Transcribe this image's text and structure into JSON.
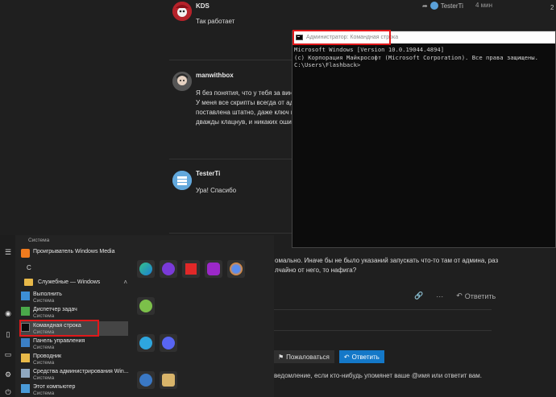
{
  "forum": {
    "posts": [
      {
        "author": "KDS",
        "lines": [
          "Так работает"
        ],
        "reply_to": "TesterTi",
        "time": "4 мин"
      },
      {
        "author": "manwithbox",
        "lines": [
          "Я без понятия, что у тебя за винда",
          "У меня все скрипты всегда от адми",
          "поставлена штатно, даже ключ имп",
          "дважды клацнув, и никаких ошибок"
        ]
      },
      {
        "author": "TesterTi",
        "lines": [
          "Ура! Спасибо"
        ]
      }
    ],
    "partial_text": [
      "омально. Иначе бы не было указаний запускать что-то там от админа, раз",
      "лчайно от него, то нафига?"
    ],
    "actions": {
      "reply": "Ответить"
    },
    "share_label": "Пожаловаться",
    "reply_button": "Ответить",
    "notice": "ведомление, если кто-нибудь упомянет ваше @имя или ответит вам.",
    "edge_digit": "2"
  },
  "cmd": {
    "title": "Администратор: Командная строка",
    "lines": [
      "Microsoft Windows [Version 10.0.19044.4894]",
      "(c) Корпорация Майкрософт (Microsoft Corporation). Все права защищены.",
      "",
      "C:\\Users\\Flashback>"
    ]
  },
  "start_menu": {
    "top_sub": "Система",
    "letter": "С",
    "group": "Служебные — Windows",
    "apps": [
      {
        "name": "Проигрыватель Windows Media",
        "sub": ""
      },
      {
        "name": "Выполнить",
        "sub": "Система"
      },
      {
        "name": "Диспетчер задач",
        "sub": "Система"
      },
      {
        "name": "Командная строка",
        "sub": "Система"
      },
      {
        "name": "Панель управления",
        "sub": "Система"
      },
      {
        "name": "Проводник",
        "sub": "Система"
      },
      {
        "name": "Средства администрирования Win...",
        "sub": "Система"
      },
      {
        "name": "Этот компьютер",
        "sub": "Система"
      }
    ]
  },
  "colors": {
    "accent": "#1478c8",
    "highlight": "#e0181a"
  }
}
